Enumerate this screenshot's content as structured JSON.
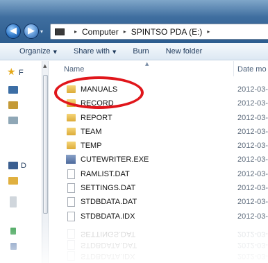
{
  "address": {
    "crumbs": [
      "Computer",
      "SPINTSO PDA (E:)"
    ],
    "separator": "▸"
  },
  "toolbar": {
    "organize": "Organize",
    "share_with": "Share with",
    "burn": "Burn",
    "new_folder": "New folder",
    "caret": "▼"
  },
  "navpane": {
    "favorites_label": "F",
    "computer_label": "D"
  },
  "columns": {
    "name": "Name",
    "date": "Date mo"
  },
  "files": [
    {
      "name": "MANUALS",
      "date": "2012-03-",
      "type": "folder"
    },
    {
      "name": "RECORD",
      "date": "2012-03-",
      "type": "folder"
    },
    {
      "name": "REPORT",
      "date": "2012-03-",
      "type": "folder"
    },
    {
      "name": "TEAM",
      "date": "2012-03-",
      "type": "folder"
    },
    {
      "name": "TEMP",
      "date": "2012-03-",
      "type": "folder"
    },
    {
      "name": "CUTEWRITER.EXE",
      "date": "2012-03-",
      "type": "exe"
    },
    {
      "name": "RAMLIST.DAT",
      "date": "2012-03-",
      "type": "file"
    },
    {
      "name": "SETTINGS.DAT",
      "date": "2012-03-",
      "type": "file"
    },
    {
      "name": "STDBDATA.DAT",
      "date": "2012-03-",
      "type": "file"
    },
    {
      "name": "STDBDATA.IDX",
      "date": "2012-03-",
      "type": "file"
    }
  ],
  "highlight": {
    "target": "MANUALS",
    "color": "#e0161b"
  }
}
